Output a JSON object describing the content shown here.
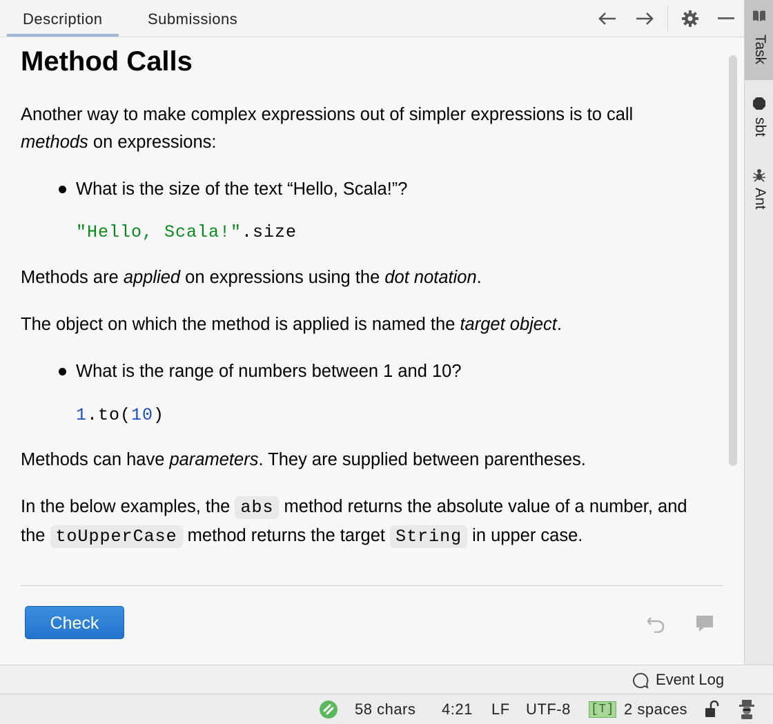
{
  "tabs": {
    "description": "Description",
    "submissions": "Submissions"
  },
  "toolbar_icons": [
    "arrow-left-icon",
    "arrow-right-icon",
    "gear-icon",
    "minimize-icon"
  ],
  "task": {
    "title": "Method Calls",
    "p1_a": "Another way to make complex expressions out of simpler expressions is to call ",
    "p1_em": "methods",
    "p1_b": " on expressions:",
    "bullet1": "What is the size of the text “Hello, Scala!”?",
    "code1_str": "\"Hello, Scala!\"",
    "code1_rest": ".size",
    "p2_a": "Methods are ",
    "p2_em1": "applied",
    "p2_b": " on expressions using the ",
    "p2_em2": "dot notation",
    "p2_c": ".",
    "p3_a": "The object on which the method is applied is named the ",
    "p3_em": "target object",
    "p3_b": ".",
    "bullet2": "What is the range of numbers between 1 and 10?",
    "code2_n1": "1",
    "code2_mid": ".to(",
    "code2_n2": "10",
    "code2_end": ")",
    "p4_a": "Methods can have ",
    "p4_em": "parameters",
    "p4_b": ". They are supplied between parentheses.",
    "p5_a": "In the below examples, the ",
    "p5_code1": "abs",
    "p5_b": " method returns the absolute value of a number, and the ",
    "p5_code2": "toUpperCase",
    "p5_c": " method returns the target ",
    "p5_code3": "String",
    "p5_d": " in upper case."
  },
  "check_button": "Check",
  "right_strip": {
    "task": "Task",
    "sbt": "sbt",
    "ant": "Ant"
  },
  "event_log": "Event Log",
  "status": {
    "chars": "58 chars",
    "position": "4:21",
    "line_sep": "LF",
    "encoding": "UTF-8",
    "type_badge": "[T]",
    "indent": "2 spaces"
  },
  "colors": {
    "accent": "#2374cc",
    "string": "#0a8a1a",
    "number": "#1d50c8",
    "status_ok": "#5cb85c"
  }
}
